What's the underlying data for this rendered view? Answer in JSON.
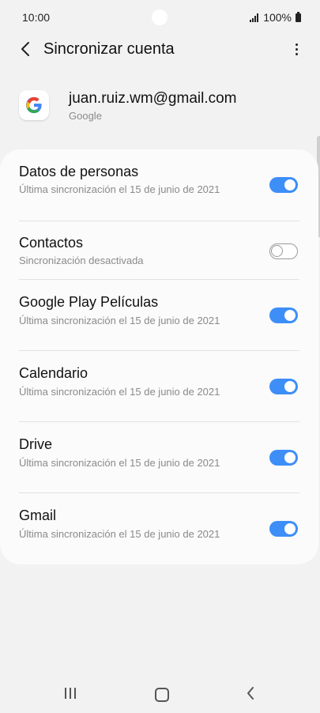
{
  "status_bar": {
    "time": "10:00",
    "battery_text": "100%"
  },
  "app_bar": {
    "title": "Sincronizar cuenta",
    "back_icon": "chevron-left-icon",
    "more_icon": "more-vertical-icon"
  },
  "account": {
    "email": "juan.ruiz.wm@gmail.com",
    "provider": "Google",
    "logo_icon": "google-logo"
  },
  "sync_items": [
    {
      "label": "Datos de personas",
      "sub": "Última sincronización el 15 de junio de 2021",
      "enabled": true
    },
    {
      "label": "Contactos",
      "sub": "Sincronización desactivada",
      "enabled": false
    },
    {
      "label": "Google Play Películas",
      "sub": "Última sincronización el 15 de junio de 2021",
      "enabled": true
    },
    {
      "label": "Calendario",
      "sub": "Última sincronización el 15 de junio de 2021",
      "enabled": true
    },
    {
      "label": "Drive",
      "sub": "Última sincronización el 15 de junio de 2021",
      "enabled": true
    },
    {
      "label": "Gmail",
      "sub": "Última sincronización el 15 de junio de 2021",
      "enabled": true
    }
  ],
  "colors": {
    "accent": "#3e8ef7",
    "background": "#f2f2f2",
    "card": "#fbfbfb"
  },
  "nav_bar": {
    "recent_icon": "recent-apps-icon",
    "home_icon": "home-icon",
    "back_icon": "back-icon"
  }
}
